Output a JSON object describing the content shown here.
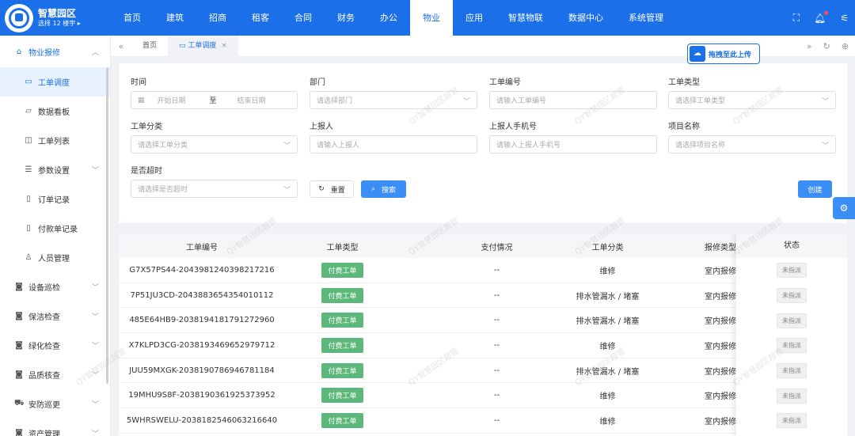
{
  "app": {
    "title": "智慧园区",
    "subtitle": "选择 12 楼宇 ▸"
  },
  "nav": [
    "首页",
    "建筑",
    "招商",
    "租客",
    "合同",
    "财务",
    "办公",
    "物业",
    "应用",
    "智慧物联",
    "数据中心",
    "系统管理"
  ],
  "nav_active": "物业",
  "sidebar": {
    "group": "物业报修",
    "items": [
      "工单调度",
      "数据看板",
      "工单列表",
      "参数设置",
      "订单记录",
      "付款单记录",
      "人员管理"
    ],
    "sections": [
      "设备巡检",
      "保洁检查",
      "绿化检查",
      "品质核查",
      "安防巡更",
      "资产管理"
    ]
  },
  "tabs": {
    "home": "首页",
    "active": "工单调度",
    "close": "×"
  },
  "upload": {
    "label": "拖拽至此上传"
  },
  "filter": {
    "time_label": "时间",
    "start_ph": "开始日期",
    "sep": "至",
    "end_ph": "结束日期",
    "dept_label": "部门",
    "dept_ph": "请选择部门",
    "no_label": "工单编号",
    "no_ph": "请输入工单编号",
    "type_label": "工单类型",
    "type_ph": "请选择工单类型",
    "cat_label": "工单分类",
    "cat_ph": "请选择工单分类",
    "reporter_label": "上报人",
    "reporter_ph": "请输入上报人",
    "phone_label": "上报人手机号",
    "phone_ph": "请输入上报人手机号",
    "project_label": "项目名称",
    "project_ph": "请选择项目名称",
    "overtime_label": "是否超时",
    "overtime_ph": "请选择是否超时",
    "reset": "重置",
    "search": "搜索",
    "create": "创建"
  },
  "table": {
    "headers": [
      "工单编号",
      "工单类型",
      "支付情况",
      "工单分类",
      "报修类型",
      "状态"
    ],
    "rows": [
      [
        "G7X57PS44-2043981240398217216",
        "付费工单",
        "--",
        "维修",
        "室内报修",
        "未指派"
      ],
      [
        "7P51JU3CD-2043883654354010112",
        "付费工单",
        "--",
        "排水管漏水 / 堵塞",
        "室内报修",
        "未指派"
      ],
      [
        "485E64HB9-2038194181791272960",
        "付费工单",
        "--",
        "排水管漏水 / 堵塞",
        "室内报修",
        "未指派"
      ],
      [
        "X7KLPD3CG-2038193469652979712",
        "付费工单",
        "--",
        "维修",
        "室内报修",
        "未指派"
      ],
      [
        "JUU59MXGK-2038190786946781184",
        "付费工单",
        "--",
        "排水管漏水 / 堵塞",
        "室内报修",
        "未指派"
      ],
      [
        "19MHU9S8F-2038190361925373952",
        "付费工单",
        "--",
        "维修",
        "室内报修",
        "未指派"
      ],
      [
        "5WHRSWELU-2038182546063216640",
        "付费工单",
        "--",
        "维修",
        "室内报修",
        "未指派"
      ]
    ]
  },
  "watermark": "QY智慧园区超管",
  "colors": {
    "primary": "#1b6fe8",
    "tag_green": "#5cb87a",
    "button_blue": "#3a8ef6"
  }
}
